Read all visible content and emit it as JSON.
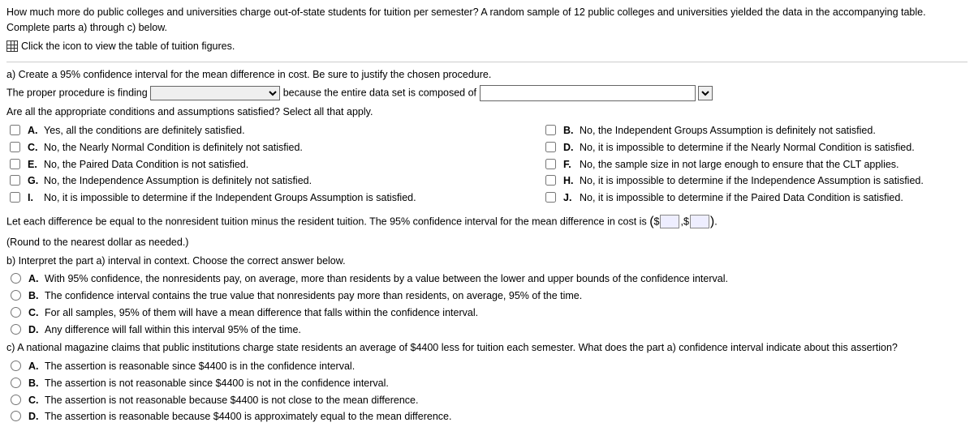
{
  "intro": "How much more do public colleges and universities charge out-of-state students for tuition per semester? A random sample of 12 public colleges and universities yielded the data in the accompanying table. Complete parts a) through c) below.",
  "tableLink": "Click the icon to view the table of tuition figures.",
  "partA": {
    "prompt": "a) Create a 95% confidence interval for the mean difference in cost. Be sure to justify the chosen procedure.",
    "sentence1_pre": "The proper procedure is finding",
    "sentence1_mid": "because the entire data set is composed of",
    "conditionsPrompt": "Are all the appropriate conditions and assumptions satisfied? Select all that apply.",
    "checks": {
      "A": "Yes, all the conditions are definitely satisfied.",
      "B": "No, the Independent Groups Assumption is definitely not satisfied.",
      "C": "No, the Nearly Normal Condition is definitely not satisfied.",
      "D": "No, it is impossible to determine if the Nearly Normal Condition is satisfied.",
      "E": "No, the Paired Data Condition is not satisfied.",
      "F": "No, the sample size in not large enough to ensure that the CLT applies.",
      "G": "No, the Independence Assumption is definitely not satisfied.",
      "H": "No, it is impossible to determine if the Independence Assumption is satisfied.",
      "I": "No, it is impossible to determine if the Independent Groups Assumption is satisfied.",
      "J": "No, it is impossible to determine if the Paired Data Condition is satisfied."
    },
    "diffSentence_pre": "Let each difference be equal to the nonresident tuition minus the resident tuition. The 95% confidence interval for the mean difference in cost is",
    "diffSentence_post": ".",
    "roundHint": "(Round to the nearest dollar as needed.)"
  },
  "partB": {
    "prompt": "b) Interpret the part a) interval in context. Choose the correct answer below.",
    "opts": {
      "A": "With 95% confidence, the nonresidents pay, on average, more than residents by a value between the lower and upper bounds of the confidence interval.",
      "B": "The confidence interval contains the true value that nonresidents pay more than residents, on average, 95% of the time.",
      "C": "For all samples, 95% of them will have a mean difference that falls within the confidence interval.",
      "D": "Any difference will fall within this interval 95% of the time."
    }
  },
  "partC": {
    "prompt": "c) A national magazine claims that public institutions charge state residents an average of $4400 less for tuition each semester. What does the part a) confidence interval indicate about this assertion?",
    "opts": {
      "A": "The assertion is reasonable since $4400 is in the confidence interval.",
      "B": "The assertion is not reasonable since $4400 is not in the confidence interval.",
      "C": "The assertion is not reasonable because $4400 is not close to the mean difference.",
      "D": "The assertion is reasonable because $4400 is approximately equal to the mean difference."
    }
  }
}
